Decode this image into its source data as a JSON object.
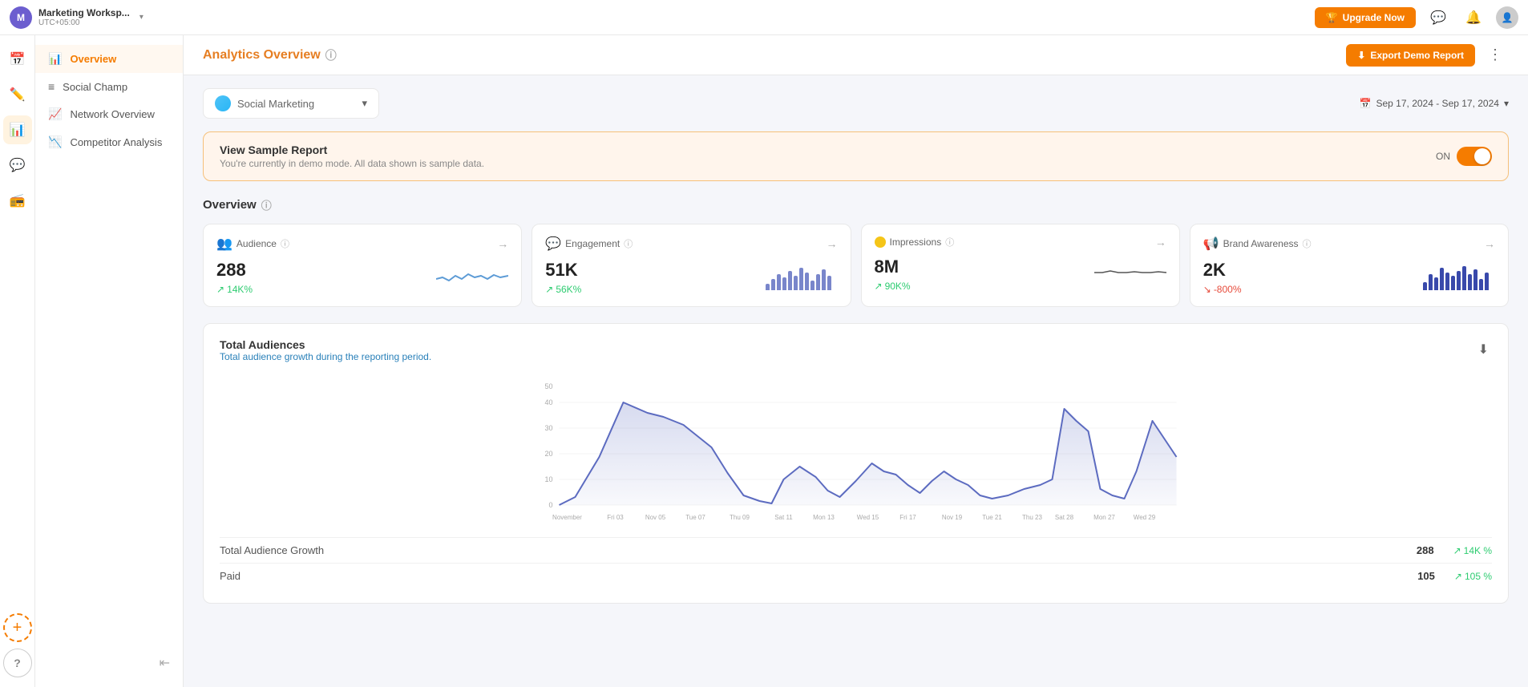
{
  "topNav": {
    "workspace": {
      "initial": "M",
      "name": "Marketing Worksp...",
      "timezone": "UTC+05:00",
      "chevron": "▾"
    },
    "upgradeBtn": "Upgrade Now",
    "icons": {
      "messages": "💬",
      "notifications": "🔔",
      "user": "👤"
    }
  },
  "iconSidebar": {
    "items": [
      {
        "name": "calendar-icon",
        "icon": "📅",
        "active": false
      },
      {
        "name": "compose-icon",
        "icon": "✏️",
        "active": false
      },
      {
        "name": "analytics-icon",
        "icon": "📊",
        "active": true
      },
      {
        "name": "engage-icon",
        "icon": "💬",
        "active": false
      },
      {
        "name": "listen-icon",
        "icon": "📻",
        "active": false
      }
    ],
    "bottom": [
      {
        "name": "add-icon",
        "icon": "+"
      },
      {
        "name": "help-icon",
        "icon": "?"
      }
    ]
  },
  "navSidebar": {
    "items": [
      {
        "label": "Overview",
        "icon": "📊",
        "active": true
      },
      {
        "label": "Social Champ",
        "icon": "≡",
        "active": false
      },
      {
        "label": "Network Overview",
        "icon": "📈",
        "active": false
      },
      {
        "label": "Competitor Analysis",
        "icon": "📉",
        "active": false
      }
    ]
  },
  "pageHeader": {
    "title": "Analytics Overview",
    "helpIcon": "ⓘ",
    "exportBtn": "Export Demo Report",
    "exportIcon": "⬇"
  },
  "filterBar": {
    "account": {
      "name": "Social Marketing",
      "placeholder": "Social Marketing"
    },
    "dateRange": {
      "label": "Sep 17, 2024 - Sep 17, 2024",
      "icon": "📅"
    }
  },
  "demoBanner": {
    "title": "View Sample Report",
    "subtitle": "You're currently in demo mode. All data shown is sample data.",
    "toggleLabel": "ON"
  },
  "overview": {
    "sectionTitle": "Overview",
    "helpIcon": "ⓘ",
    "metrics": [
      {
        "label": "Audience",
        "icon": "👥",
        "value": "288",
        "change": "14K%",
        "changeType": "up",
        "chartType": "sparkline"
      },
      {
        "label": "Engagement",
        "icon": "💬",
        "value": "51K",
        "change": "56K%",
        "changeType": "up",
        "chartType": "bars"
      },
      {
        "label": "Impressions",
        "icon": "⭕",
        "value": "8M",
        "change": "90K%",
        "changeType": "up",
        "chartType": "flat"
      },
      {
        "label": "Brand Awareness",
        "icon": "📢",
        "value": "2K",
        "change": "-800%",
        "changeType": "down",
        "chartType": "bars2"
      }
    ]
  },
  "totalAudiences": {
    "title": "Total Audiences",
    "subtitle": "Total audience growth during the reporting period.",
    "yLabels": [
      "50",
      "40",
      "30",
      "20",
      "10",
      "0"
    ],
    "xLabels": [
      "November",
      "Fri 03",
      "Nov 05",
      "Tue 07",
      "Thu 09",
      "Sat 11",
      "Mon 13",
      "Wed 15",
      "Fri 17",
      "Nov 19",
      "Tue 21",
      "Thu 23",
      "Sat 28",
      "Mon 27",
      "Wed 29"
    ]
  },
  "tableData": [
    {
      "label": "Total Audience Growth",
      "value": "288",
      "change": "14K %",
      "changeType": "up"
    },
    {
      "label": "Paid",
      "value": "105",
      "change": "105 %",
      "changeType": "up"
    }
  ]
}
